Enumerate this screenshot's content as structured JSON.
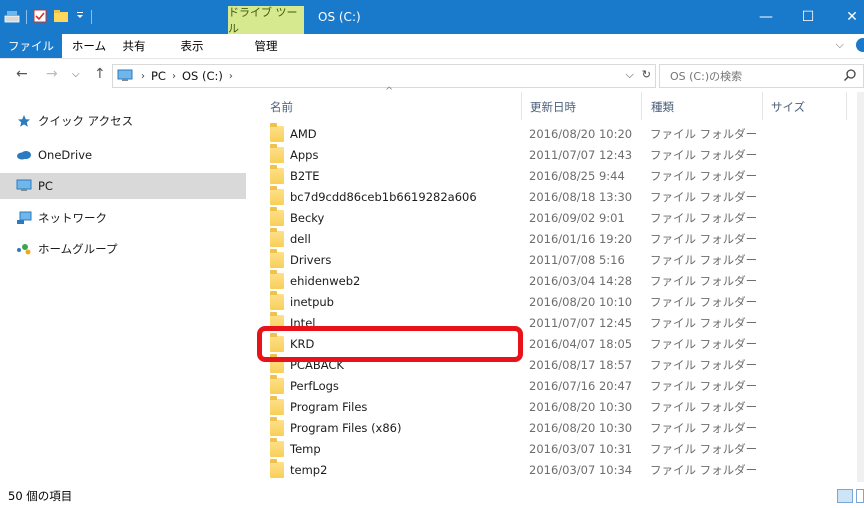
{
  "titlebar": {
    "context_tab": "ドライブ ツール",
    "title": "OS (C:)",
    "minimize": "—",
    "maximize": "☐",
    "close": "✕"
  },
  "ribbon": {
    "tabs": [
      {
        "label": "ファイル"
      },
      {
        "label": "ホーム"
      },
      {
        "label": "共有"
      },
      {
        "label": "表示"
      },
      {
        "label": "管理"
      }
    ]
  },
  "address": {
    "crumbs": [
      "PC",
      "OS (C:)"
    ],
    "search_placeholder": "OS (C:)の検索"
  },
  "navpane": {
    "items": [
      {
        "label": "クイック アクセス",
        "icon": "star-icon"
      },
      {
        "label": "OneDrive",
        "icon": "cloud-icon"
      },
      {
        "label": "PC",
        "icon": "monitor-icon",
        "selected": true
      },
      {
        "label": "ネットワーク",
        "icon": "network-icon"
      },
      {
        "label": "ホームグループ",
        "icon": "homegroup-icon"
      }
    ]
  },
  "columns": {
    "name": "名前",
    "date": "更新日時",
    "type": "種類",
    "size": "サイズ"
  },
  "files": [
    {
      "name": "AMD",
      "date": "2016/08/20 10:20",
      "type": "ファイル フォルダー"
    },
    {
      "name": "Apps",
      "date": "2011/07/07 12:43",
      "type": "ファイル フォルダー"
    },
    {
      "name": "B2TE",
      "date": "2016/08/25 9:44",
      "type": "ファイル フォルダー"
    },
    {
      "name": "bc7d9cdd86ceb1b6619282a606",
      "date": "2016/08/18 13:30",
      "type": "ファイル フォルダー"
    },
    {
      "name": "Becky",
      "date": "2016/09/02 9:01",
      "type": "ファイル フォルダー"
    },
    {
      "name": "dell",
      "date": "2016/01/16 19:20",
      "type": "ファイル フォルダー"
    },
    {
      "name": "Drivers",
      "date": "2011/07/08 5:16",
      "type": "ファイル フォルダー"
    },
    {
      "name": "ehidenweb2",
      "date": "2016/03/04 14:28",
      "type": "ファイル フォルダー"
    },
    {
      "name": "inetpub",
      "date": "2016/08/20 10:10",
      "type": "ファイル フォルダー"
    },
    {
      "name": "Intel",
      "date": "2011/07/07 12:45",
      "type": "ファイル フォルダー"
    },
    {
      "name": "KRD",
      "date": "2016/04/07 18:05",
      "type": "ファイル フォルダー"
    },
    {
      "name": "PCABACK",
      "date": "2016/08/17 18:57",
      "type": "ファイル フォルダー"
    },
    {
      "name": "PerfLogs",
      "date": "2016/07/16 20:47",
      "type": "ファイル フォルダー"
    },
    {
      "name": "Program Files",
      "date": "2016/08/20 10:30",
      "type": "ファイル フォルダー"
    },
    {
      "name": "Program Files (x86)",
      "date": "2016/08/20 10:30",
      "type": "ファイル フォルダー"
    },
    {
      "name": "Temp",
      "date": "2016/03/07 10:31",
      "type": "ファイル フォルダー"
    },
    {
      "name": "temp2",
      "date": "2016/03/07 10:34",
      "type": "ファイル フォルダー"
    }
  ],
  "status": {
    "count": "50 個の項目"
  },
  "colors": {
    "title_bar": "#1979ca",
    "context_tab": "#d7e98f",
    "highlight": "#e8131a"
  }
}
